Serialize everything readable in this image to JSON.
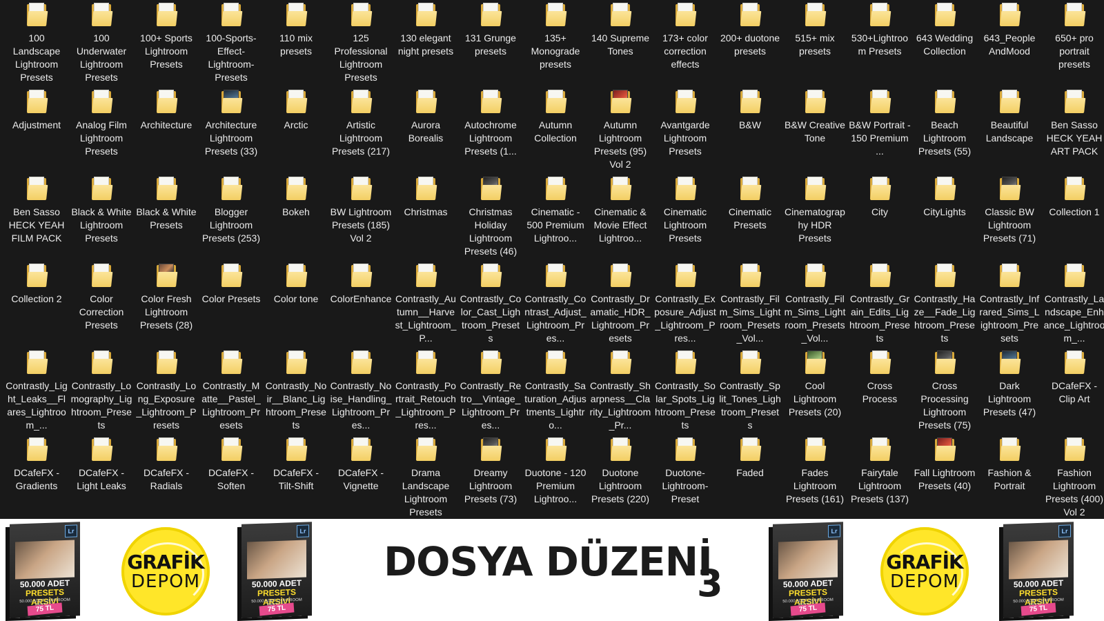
{
  "explorer": {
    "folders": [
      {
        "label": "100 Landscape Lightroom Presets",
        "thumb": "plain"
      },
      {
        "label": "100 Underwater Lightroom Presets",
        "thumb": "plain"
      },
      {
        "label": "100+ Sports Lightroom Presets",
        "thumb": "plain"
      },
      {
        "label": "100-Sports-Effect-Lightroom-Presets",
        "thumb": "plain"
      },
      {
        "label": "110 mix presets",
        "thumb": "plain"
      },
      {
        "label": "125 Professional Lightroom Presets",
        "thumb": "plain"
      },
      {
        "label": "130 elegant night presets",
        "thumb": "plain"
      },
      {
        "label": "131 Grunge presets",
        "thumb": "plain"
      },
      {
        "label": "135+ Monograde presets",
        "thumb": "plain"
      },
      {
        "label": "140 Supreme Tones",
        "thumb": "plain"
      },
      {
        "label": "173+ color correction effects",
        "thumb": "plain"
      },
      {
        "label": "200+ duotone presets",
        "thumb": "plain"
      },
      {
        "label": "515+ mix presets",
        "thumb": "plain"
      },
      {
        "label": "530+Lightroom Presets",
        "thumb": "plain"
      },
      {
        "label": "643 Wedding Collection",
        "thumb": "plain"
      },
      {
        "label": "643_People AndMood",
        "thumb": "plain"
      },
      {
        "label": "650+ pro portrait presets",
        "thumb": "plain"
      },
      {
        "label": "Adjustment",
        "thumb": "plain"
      },
      {
        "label": "Analog Film Lightroom Presets",
        "thumb": "plain"
      },
      {
        "label": "Architecture",
        "thumb": "plain"
      },
      {
        "label": "Architecture Lightroom Presets (33)",
        "thumb": "photo2"
      },
      {
        "label": "Arctic",
        "thumb": "plain"
      },
      {
        "label": "Artistic Lightroom Presets (217)",
        "thumb": "plain"
      },
      {
        "label": "Aurora Borealis",
        "thumb": "plain"
      },
      {
        "label": "Autochrome Lightroom Presets (1...",
        "thumb": "plain"
      },
      {
        "label": "Autumn Collection",
        "thumb": "plain"
      },
      {
        "label": "Autumn Lightroom Presets (95) Vol 2",
        "thumb": "photo4"
      },
      {
        "label": "Avantgarde Lightroom Presets",
        "thumb": "plain"
      },
      {
        "label": "B&W",
        "thumb": "plain"
      },
      {
        "label": "B&W Creative Tone",
        "thumb": "plain"
      },
      {
        "label": "B&W Portrait - 150 Premium ...",
        "thumb": "plain"
      },
      {
        "label": "Beach Lightroom Presets (55)",
        "thumb": "plain"
      },
      {
        "label": "Beautiful Landscape",
        "thumb": "plain"
      },
      {
        "label": "Ben Sasso HECK YEAH ART PACK",
        "thumb": "plain"
      },
      {
        "label": "Ben Sasso HECK YEAH FILM PACK",
        "thumb": "plain"
      },
      {
        "label": "Black & White Lightroom Presets",
        "thumb": "plain"
      },
      {
        "label": "Black & White Presets",
        "thumb": "plain"
      },
      {
        "label": "Blogger Lightroom Presets (253)",
        "thumb": "plain"
      },
      {
        "label": "Bokeh",
        "thumb": "plain"
      },
      {
        "label": "BW Lightroom Presets (185) Vol 2",
        "thumb": "plain"
      },
      {
        "label": "Christmas",
        "thumb": "plain"
      },
      {
        "label": "Christmas Holiday Lightroom Presets (46)",
        "thumb": "photo5"
      },
      {
        "label": "Cinematic - 500 Premium Lightroo...",
        "thumb": "plain"
      },
      {
        "label": "Cinematic & Movie Effect Lightroo...",
        "thumb": "plain"
      },
      {
        "label": "Cinematic Lightroom Presets",
        "thumb": "plain"
      },
      {
        "label": "Cinematic Presets",
        "thumb": "plain"
      },
      {
        "label": "Cinematography HDR Presets",
        "thumb": "plain"
      },
      {
        "label": "City",
        "thumb": "plain"
      },
      {
        "label": "CityLights",
        "thumb": "plain"
      },
      {
        "label": "Classic BW Lightroom Presets (71)",
        "thumb": "photo5"
      },
      {
        "label": "Collection 1",
        "thumb": "plain"
      },
      {
        "label": "Collection 2",
        "thumb": "plain"
      },
      {
        "label": "Color Correction Presets",
        "thumb": "plain"
      },
      {
        "label": "Color Fresh Lightroom Presets (28)",
        "thumb": "photo"
      },
      {
        "label": "Color Presets",
        "thumb": "plain"
      },
      {
        "label": "Color tone",
        "thumb": "plain"
      },
      {
        "label": "ColorEnhance",
        "thumb": "plain"
      },
      {
        "label": "Contrastly_Autumn__Harvest_Lightroom_P...",
        "thumb": "plain"
      },
      {
        "label": "Contrastly_Color_Cast_Lightroom_Presets",
        "thumb": "plain"
      },
      {
        "label": "Contrastly_Contrast_Adjust_Lightroom_Pres...",
        "thumb": "plain"
      },
      {
        "label": "Contrastly_Dramatic_HDR_Lightroom_Presets",
        "thumb": "plain"
      },
      {
        "label": "Contrastly_Exposure_Adjust_Lightroom_Pres...",
        "thumb": "plain"
      },
      {
        "label": "Contrastly_Film_Sims_Lightroom_Presets_Vol...",
        "thumb": "plain"
      },
      {
        "label": "Contrastly_Film_Sims_Lightroom_Presets_Vol...",
        "thumb": "plain"
      },
      {
        "label": "Contrastly_Grain_Edits_Lightroom_Presets",
        "thumb": "plain"
      },
      {
        "label": "Contrastly_Haze__Fade_Lightroom_Presets",
        "thumb": "plain"
      },
      {
        "label": "Contrastly_Infrared_Sims_Lightroom_Presets",
        "thumb": "plain"
      },
      {
        "label": "Contrastly_Landscape_Enhance_Lightroom_...",
        "thumb": "plain"
      },
      {
        "label": "Contrastly_Light_Leaks__Flares_Lightroom_...",
        "thumb": "plain"
      },
      {
        "label": "Contrastly_Lomography_Lightroom_Presets",
        "thumb": "plain"
      },
      {
        "label": "Contrastly_Long_Exposure_Lightroom_Presets",
        "thumb": "plain"
      },
      {
        "label": "Contrastly_Matte__Pastel_Lightroom_Presets",
        "thumb": "plain"
      },
      {
        "label": "Contrastly_Noir__Blanc_Lightroom_Presets",
        "thumb": "plain"
      },
      {
        "label": "Contrastly_Noise_Handling_Lightroom_Pres...",
        "thumb": "plain"
      },
      {
        "label": "Contrastly_Portrait_Retouch_Lightroom_Pres...",
        "thumb": "plain"
      },
      {
        "label": "Contrastly_Retro__Vintage_Lightroom_Pres...",
        "thumb": "plain"
      },
      {
        "label": "Contrastly_Saturation_Adjustments_Lightro...",
        "thumb": "plain"
      },
      {
        "label": "Contrastly_Sharpness__Clarity_Lightroom_Pr...",
        "thumb": "plain"
      },
      {
        "label": "Contrastly_Solar_Spots_Lightroom_Presets",
        "thumb": "plain"
      },
      {
        "label": "Contrastly_Split_Tones_Lightroom_Presets",
        "thumb": "plain"
      },
      {
        "label": "Cool Lightroom Presets (20)",
        "thumb": "photo3"
      },
      {
        "label": "Cross Process",
        "thumb": "plain"
      },
      {
        "label": "Cross Processing Lightroom Presets (75)",
        "thumb": "photo5"
      },
      {
        "label": "Dark Lightroom Presets (47)",
        "thumb": "photo2"
      },
      {
        "label": "DCafeFX - Clip Art",
        "thumb": "plain"
      },
      {
        "label": "DCafeFX - Gradients",
        "thumb": "plain"
      },
      {
        "label": "DCafeFX - Light Leaks",
        "thumb": "plain"
      },
      {
        "label": "DCafeFX - Radials",
        "thumb": "plain"
      },
      {
        "label": "DCafeFX - Soften",
        "thumb": "plain"
      },
      {
        "label": "DCafeFX - Tilt-Shift",
        "thumb": "plain"
      },
      {
        "label": "DCafeFX - Vignette",
        "thumb": "plain"
      },
      {
        "label": "Drama Landscape Lightroom Presets",
        "thumb": "plain"
      },
      {
        "label": "Dreamy Lightroom Presets (73)",
        "thumb": "photo5"
      },
      {
        "label": "Duotone - 120 Premium Lightroo...",
        "thumb": "plain"
      },
      {
        "label": "Duotone Lightroom Presets (220)",
        "thumb": "plain"
      },
      {
        "label": "Duotone-Lightroom-Preset",
        "thumb": "plain"
      },
      {
        "label": "Faded",
        "thumb": "plain"
      },
      {
        "label": "Fades Lightroom Presets (161)",
        "thumb": "plain"
      },
      {
        "label": "Fairytale Lightroom Presets (137)",
        "thumb": "plain"
      },
      {
        "label": "Fall Lightroom Presets (40)",
        "thumb": "photo4"
      },
      {
        "label": "Fashion & Portrait",
        "thumb": "plain"
      },
      {
        "label": "Fashion Lightroom Presets (400) Vol 2",
        "thumb": "plain"
      }
    ]
  },
  "banner": {
    "title": "DOSYA DÜZENİ",
    "number": "3",
    "logo_line1": "GRAFİK",
    "logo_line2": "DEPOM",
    "box_line1": "50.000 ADET",
    "box_line2": "PRESETS ARŞİVİ",
    "box_sub": "50.000 ADET LIGHTROOM PRESETS",
    "box_price": "75 TL",
    "box_badge": "Lr"
  },
  "colors": {
    "explorer_bg": "#191919",
    "folder_yellow": "#f3cf63",
    "label_text": "#ececec",
    "logo_yellow": "#ffe629",
    "price_pink": "#e64a8c"
  }
}
